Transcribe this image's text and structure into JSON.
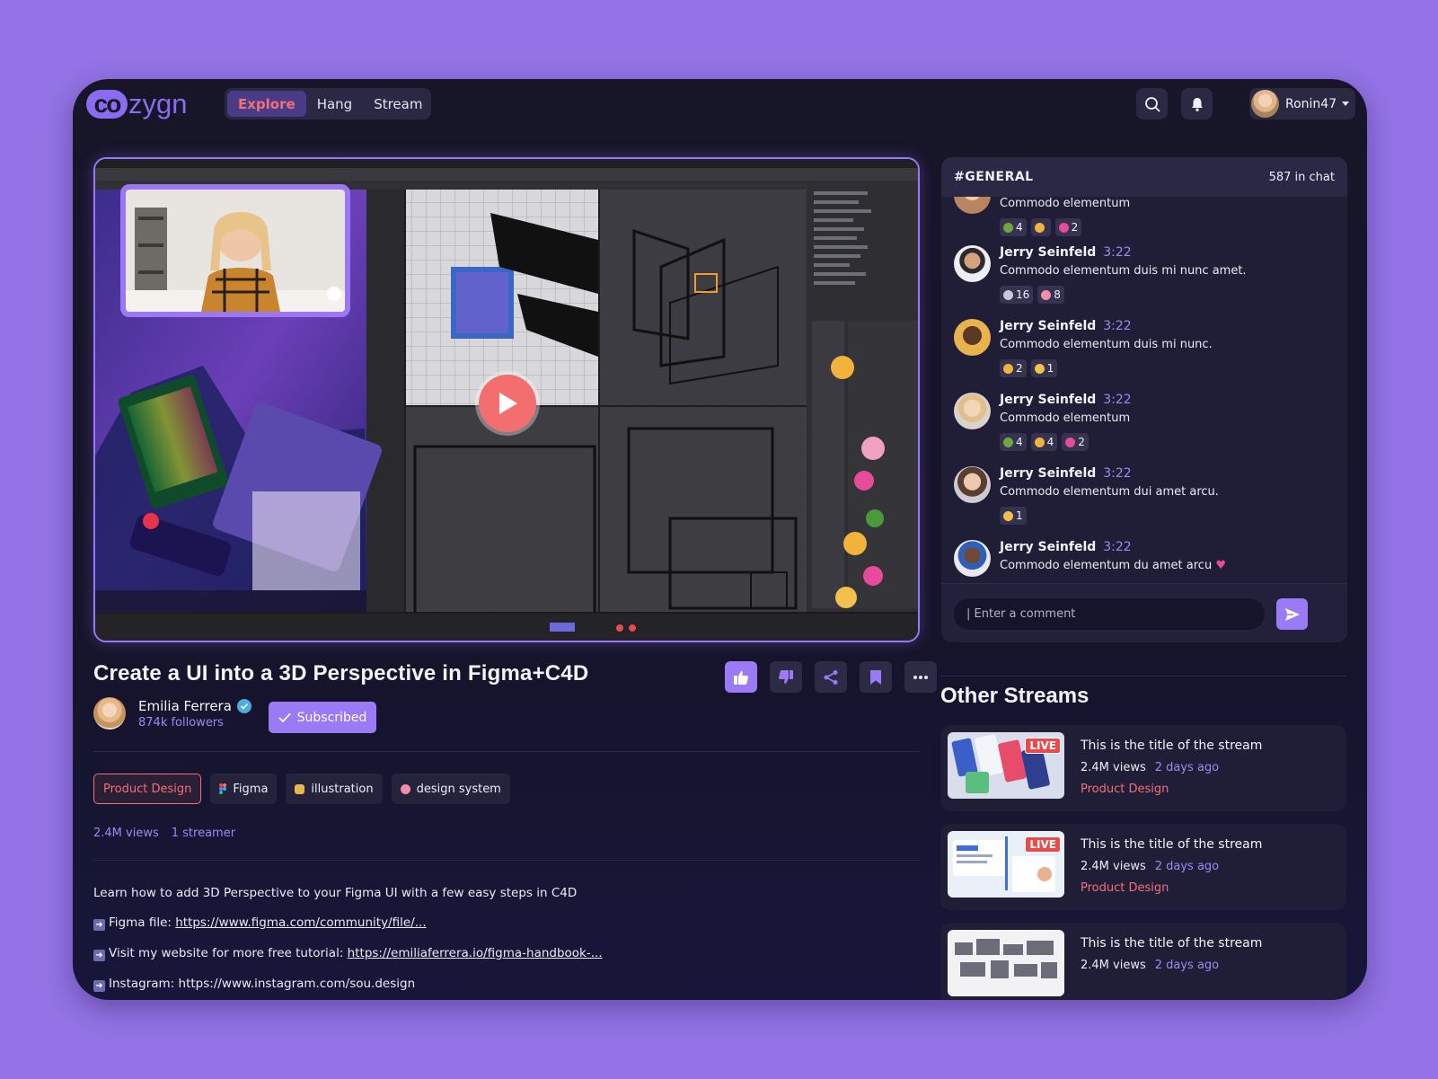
{
  "app": {
    "logo_co": "co",
    "logo_rest": "zygn",
    "nav": [
      {
        "label": "Explore",
        "active": true
      },
      {
        "label": "Hang",
        "active": false
      },
      {
        "label": "Stream",
        "active": false
      }
    ],
    "user": {
      "name": "Ronin47"
    },
    "icons": {
      "search": "search-icon",
      "notifications": "bell-icon",
      "menu": "caret-down-icon"
    }
  },
  "video": {
    "title": "Create a UI into a 3D Perspective in Figma+C4D",
    "creator": {
      "name": "Emilia Ferrera",
      "followers": "874k followers",
      "verified": true
    },
    "subscribe_label": "Subscribed",
    "tags": [
      {
        "label": "Product Design",
        "active": true
      },
      {
        "label": "Figma",
        "active": false
      },
      {
        "label": "illustration",
        "active": false
      },
      {
        "label": "design system",
        "active": false
      }
    ],
    "views": "2.4M views",
    "streamers": "1 streamer",
    "description": "Learn how to add 3D Perspective to your Figma UI with a few easy steps in C4D",
    "links": [
      {
        "prefix": "Figma file: ",
        "url": "https://www.figma.com/community/file/..."
      },
      {
        "prefix": "Visit my website for more free tutorial: ",
        "url": "https://emiliaferrera.io/figma-handbook-..."
      },
      {
        "prefix": "Instagram: ",
        "url": "https://www.instagram.com/sou.design"
      }
    ],
    "actions": [
      "like-icon",
      "dislike-icon",
      "share-icon",
      "bookmark-icon",
      "more-icon"
    ]
  },
  "chat": {
    "channel": "#GENERAL",
    "count": "587 in chat",
    "input_placeholder": "| Enter a comment",
    "messages": [
      {
        "name": "",
        "time": "",
        "text": "Commodo elementum",
        "reactions": [
          {
            "emoji": "plant",
            "count": "4"
          },
          {
            "emoji": "heart-eyes",
            "count": ""
          },
          {
            "emoji": "heart",
            "count": "2"
          }
        ]
      },
      {
        "name": "Jerry Seinfeld",
        "time": "3:22",
        "text": "Commodo elementum duis mi nunc amet.",
        "reactions": [
          {
            "emoji": "rocket",
            "count": "16"
          },
          {
            "emoji": "brain",
            "count": "8"
          }
        ]
      },
      {
        "name": "Jerry Seinfeld",
        "time": "3:22",
        "text": "Commodo elementum duis mi nunc.",
        "reactions": [
          {
            "emoji": "thinking",
            "count": "2"
          },
          {
            "emoji": "thumbs-up",
            "count": "1"
          }
        ]
      },
      {
        "name": "Jerry Seinfeld",
        "time": "3:22",
        "text": "Commodo elementum",
        "reactions": [
          {
            "emoji": "plant",
            "count": "4"
          },
          {
            "emoji": "heart-eyes",
            "count": "4"
          },
          {
            "emoji": "heart",
            "count": "2"
          }
        ]
      },
      {
        "name": "Jerry Seinfeld",
        "time": "3:22",
        "text": "Commodo elementum dui amet arcu.",
        "reactions": [
          {
            "emoji": "thumbs-up",
            "count": "1"
          }
        ]
      },
      {
        "name": "Jerry Seinfeld",
        "time": "3:22",
        "text": "Commodo elementum du amet arcu",
        "reactions": []
      }
    ]
  },
  "other_streams": {
    "heading": "Other Streams",
    "items": [
      {
        "title": "This is the title of the stream",
        "views": "2.4M views",
        "ago": "2 days ago",
        "category": "Product Design",
        "live": "LIVE"
      },
      {
        "title": "This is the title of the stream",
        "views": "2.4M views",
        "ago": "2 days ago",
        "category": "Product Design",
        "live": "LIVE"
      },
      {
        "title": "This is the title of the stream",
        "views": "2.4M views",
        "ago": "2 days ago",
        "category": "",
        "live": ""
      }
    ]
  },
  "colors": {
    "accent": "#9A7AF5",
    "highlight": "#F36F7A",
    "background": "#9373E5",
    "panel": "#171528"
  }
}
